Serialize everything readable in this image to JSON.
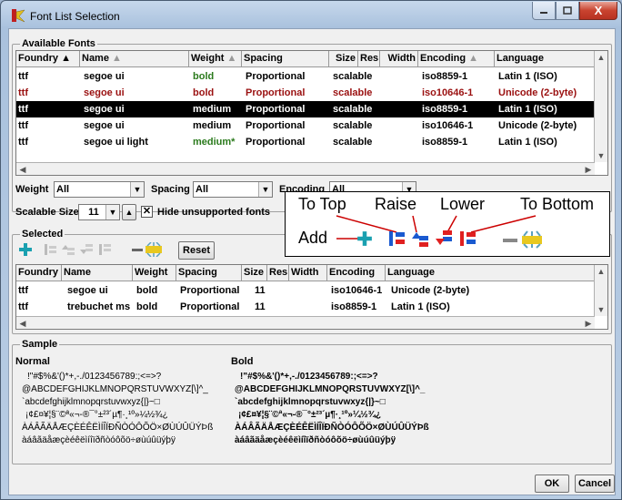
{
  "window": {
    "title": "Font List Selection",
    "close_glyph": "X"
  },
  "available": {
    "legend": "Available Fonts",
    "headers": [
      "Foundry",
      "Name",
      "Weight",
      "Spacing",
      "Size",
      "Res",
      "Width",
      "Encoding",
      "Language"
    ],
    "rows": [
      {
        "foundry": "ttf",
        "name": "segoe ui",
        "weight": "bold",
        "spacing": "Proportional",
        "size": "scalable",
        "encoding": "iso8859-1",
        "language": "Latin 1 (ISO)",
        "style": "normal",
        "weight_color": "#2a7a1c"
      },
      {
        "foundry": "ttf",
        "name": "segoe ui",
        "weight": "bold",
        "spacing": "Proportional",
        "size": "scalable",
        "encoding": "iso10646-1",
        "language": "Unicode (2-byte)",
        "style": "red",
        "weight_color": "#9a1010"
      },
      {
        "foundry": "ttf",
        "name": "segoe ui",
        "weight": "medium",
        "spacing": "Proportional",
        "size": "scalable",
        "encoding": "iso8859-1",
        "language": "Latin 1 (ISO)",
        "style": "selected",
        "weight_color": "#ffffff"
      },
      {
        "foundry": "ttf",
        "name": "segoe ui",
        "weight": "medium",
        "spacing": "Proportional",
        "size": "scalable",
        "encoding": "iso10646-1",
        "language": "Unicode (2-byte)",
        "style": "normal",
        "weight_color": "#000000"
      },
      {
        "foundry": "ttf",
        "name": "segoe ui light",
        "weight": "medium*",
        "spacing": "Proportional",
        "size": "scalable",
        "encoding": "iso8859-1",
        "language": "Latin 1 (ISO)",
        "style": "normal",
        "weight_color": "#2a7a1c"
      }
    ]
  },
  "filters": {
    "weight_label": "Weight",
    "weight_value": "All",
    "spacing_label": "Spacing",
    "spacing_value": "All",
    "encoding_label": "Encoding",
    "encoding_value": "All",
    "scalable_label": "Scalable Size",
    "scalable_value": "11",
    "hide_label": "Hide unsupported fonts",
    "hide_checked": true
  },
  "callout": {
    "to_top": "To Top",
    "raise": "Raise",
    "lower": "Lower",
    "to_bottom": "To Bottom",
    "add": "Add"
  },
  "selected": {
    "legend": "Selected",
    "reset_label": "Reset",
    "headers": [
      "Foundry",
      "Name",
      "Weight",
      "Spacing",
      "Size",
      "Res",
      "Width",
      "Encoding",
      "Language"
    ],
    "rows": [
      {
        "foundry": "ttf",
        "name": "segoe ui",
        "weight": "bold",
        "spacing": "Proportional",
        "size": "11",
        "encoding": "iso10646-1",
        "language": "Unicode (2-byte)"
      },
      {
        "foundry": "ttf",
        "name": "trebuchet ms",
        "weight": "bold",
        "spacing": "Proportional",
        "size": "11",
        "encoding": "iso8859-1",
        "language": "Latin 1 (ISO)"
      }
    ]
  },
  "sample": {
    "legend": "Sample",
    "normal_label": "Normal",
    "bold_label": "Bold",
    "lines": [
      "!\"#$%&'()*+,-./0123456789:;<=>?",
      "@ABCDEFGHIJKLMNOPQRSTUVWXYZ[\\]^_",
      "`abcdefghijklmnopqrstuvwxyz{|}~□",
      "¡¢£¤¥¦§¨©ª«¬-®¯°±²³´µ¶·¸¹º»¼½¾¿",
      "ÀÁÂÃÄÅÆÇÈÉÊËÌÍÎÏÐÑÒÓÔÕÖ×ØÙÚÛÜÝÞß",
      "àáâãäåæçèéêëìíîïðñòóôõö÷øùúûüýþÿ"
    ]
  },
  "buttons": {
    "ok": "OK",
    "cancel": "Cancel"
  }
}
